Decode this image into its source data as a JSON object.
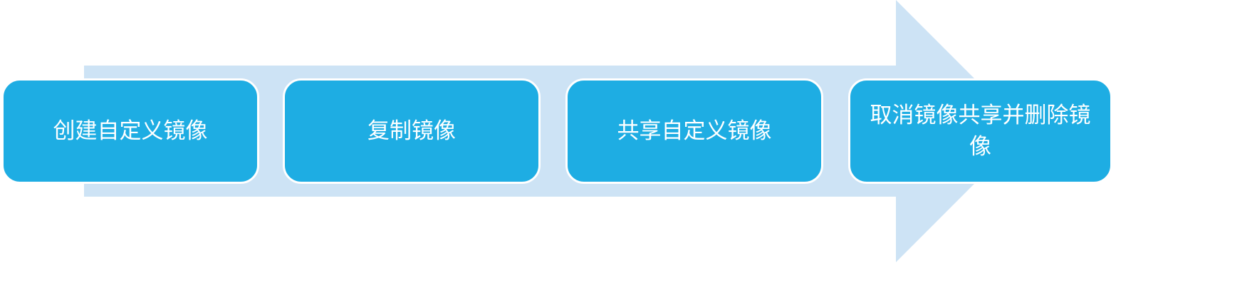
{
  "colors": {
    "arrow": "#cde3f5",
    "box": "#1eade3",
    "text": "#ffffff"
  },
  "steps": [
    {
      "label": "创建自定义镜像"
    },
    {
      "label": "复制镜像"
    },
    {
      "label": "共享自定义镜像"
    },
    {
      "label": "取消镜像共享并删除镜像"
    }
  ]
}
